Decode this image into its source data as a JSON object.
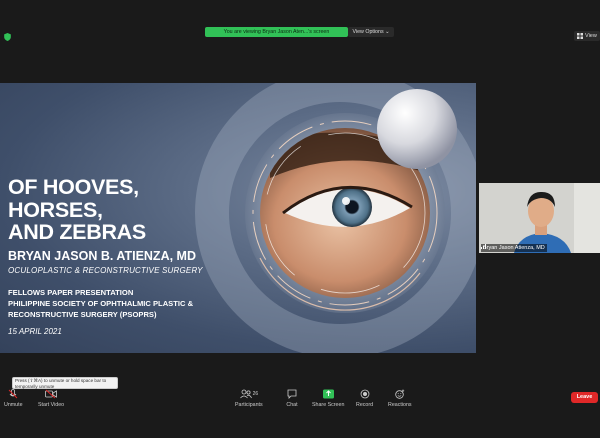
{
  "top_bar": {
    "sharing_banner": "You are viewing Bryan Jason Aten...'s screen",
    "view_options_label": "View Options ⌄",
    "view_button_label": "View"
  },
  "slide": {
    "title_lines": [
      "OF HOOVES,",
      "HORSES,",
      "AND ZEBRAS"
    ],
    "author": "BRYAN JASON B. ATIENZA, MD",
    "subtitle": "OCULOPLASTIC & RECONSTRUCTIVE SURGERY",
    "presentation_lines": [
      "FELLOWS PAPER PRESENTATION",
      "PHILIPPINE SOCIETY OF OPHTHALMIC PLASTIC &",
      "RECONSTRUCTIVE SURGERY (PSOPRS)"
    ],
    "date": "15 APRIL 2021"
  },
  "participant_video": {
    "name": "Bryan Jason Atienza, MD"
  },
  "tooltip": {
    "text": "Press (⇧⌘A) to unmute or hold space bar to temporarily unmute"
  },
  "toolbar": {
    "unmute_label": "Unmute",
    "start_video_label": "Start Video",
    "participants_label": "Participants",
    "participants_count": "26",
    "chat_label": "Chat",
    "share_screen_label": "Share Screen",
    "record_label": "Record",
    "reactions_label": "Reactions",
    "leave_label": "Leave"
  },
  "colors": {
    "share_green": "#31c157",
    "leave_red": "#e02828",
    "background": "#1a1a1a",
    "slide_blue": "#4a5a75"
  }
}
